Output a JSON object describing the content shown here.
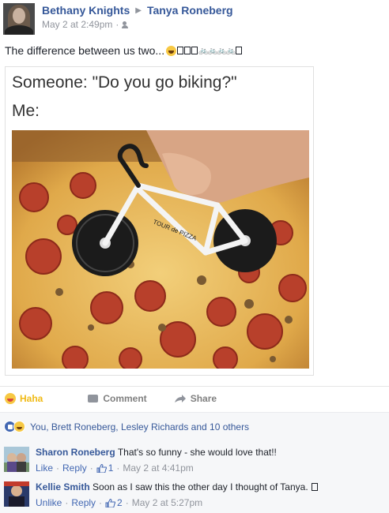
{
  "post": {
    "author": "Bethany Knights",
    "recipient": "Tanya Roneberg",
    "timestamp": "May 2 at 2:49pm",
    "privacy_icon": "friends-icon",
    "text": "The difference between us two...",
    "meme": {
      "line1": "Someone: \"Do you go biking?\"",
      "line2": "Me:",
      "bike_label": "TOUR de PIZZA"
    }
  },
  "actions": {
    "haha": "Haha",
    "comment": "Comment",
    "share": "Share"
  },
  "reactions": {
    "summary": "You, Brett Roneberg, Lesley Richards and 10 others"
  },
  "comments": [
    {
      "name": "Sharon Roneberg",
      "text": "That's so funny - she would love that!!",
      "like": "Like",
      "reply": "Reply",
      "likes": "1",
      "time": "May 2 at 4:41pm"
    },
    {
      "name": "Kellie Smith",
      "text": "Soon as I saw this the other day I thought of Tanya.",
      "like": "Unlike",
      "reply": "Reply",
      "likes": "2",
      "time": "May 2 at 5:27pm"
    }
  ],
  "colors": {
    "link": "#365899",
    "haha": "#f0ba15",
    "muted": "#90949c",
    "panel": "#f6f7f9"
  }
}
